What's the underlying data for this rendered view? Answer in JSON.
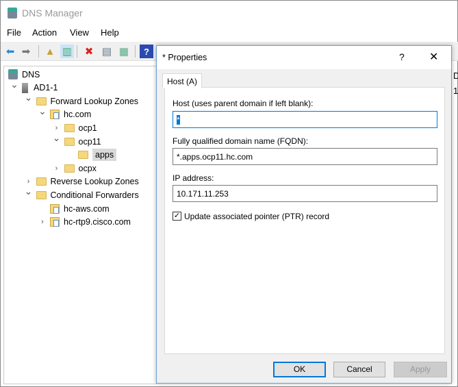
{
  "window": {
    "title": "DNS Manager"
  },
  "menu": [
    "File",
    "Action",
    "View",
    "Help"
  ],
  "toolbar": [
    {
      "icon": "back-arrow-icon",
      "glyph": "⬅"
    },
    {
      "icon": "forward-arrow-icon",
      "glyph": "➡"
    },
    {
      "icon": "up-folder-icon",
      "glyph": "▲"
    },
    {
      "icon": "show-hide-console-tree-icon",
      "glyph": "▥"
    },
    {
      "icon": "delete-icon",
      "glyph": "✖"
    },
    {
      "icon": "properties-icon",
      "glyph": "▤"
    },
    {
      "icon": "export-list-icon",
      "glyph": "▦"
    },
    {
      "icon": "help-icon",
      "glyph": "?"
    }
  ],
  "tree": [
    {
      "label": "DNS",
      "level": 0,
      "icon": "dns-icon",
      "chevron": ""
    },
    {
      "label": "AD1-1",
      "level": 1,
      "icon": "server-icon",
      "chevron": "down"
    },
    {
      "label": "Forward Lookup Zones",
      "level": 2,
      "icon": "folder-icon",
      "chevron": "down"
    },
    {
      "label": "hc.com",
      "level": 3,
      "icon": "zone-icon",
      "chevron": "down"
    },
    {
      "label": "ocp1",
      "level": 4,
      "icon": "folder-icon",
      "chevron": "right"
    },
    {
      "label": "ocp11",
      "level": 4,
      "icon": "folder-icon",
      "chevron": "down"
    },
    {
      "label": "apps",
      "level": 5,
      "icon": "folder-icon",
      "chevron": "",
      "selected": true
    },
    {
      "label": "ocpx",
      "level": 4,
      "icon": "folder-icon",
      "chevron": "right"
    },
    {
      "label": "Reverse Lookup Zones",
      "level": 2,
      "icon": "folder-icon",
      "chevron": "right"
    },
    {
      "label": "Conditional Forwarders",
      "level": 2,
      "icon": "folder-icon",
      "chevron": "down"
    },
    {
      "label": "hc-aws.com",
      "level": 3,
      "icon": "zone-icon",
      "chevron": ""
    },
    {
      "label": "hc-rtp9.cisco.com",
      "level": 3,
      "icon": "zone-icon",
      "chevron": "right"
    }
  ],
  "background_partial": [
    "D",
    "1"
  ],
  "dialog": {
    "title": "* Properties",
    "help": "?",
    "close": "✕",
    "tab": "Host (A)",
    "host_label": "Host (uses parent domain if left blank):",
    "host_value": "*",
    "fqdn_label": "Fully qualified domain name (FQDN):",
    "fqdn_value": "*.apps.ocp11.hc.com",
    "ip_label": "IP address:",
    "ip_value": "10.171.11.253",
    "ptr_label": "Update associated pointer (PTR) record",
    "ptr_checked": true,
    "ok": "OK",
    "cancel": "Cancel",
    "apply": "Apply"
  }
}
